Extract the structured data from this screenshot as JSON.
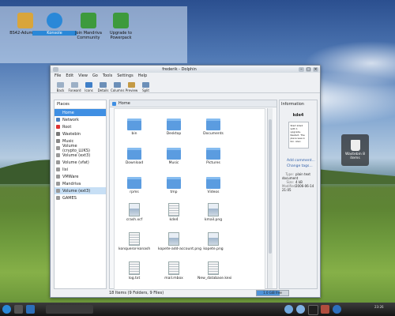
{
  "launcher": {
    "items": [
      {
        "label": "BS42-Adumicon",
        "color": "#d9a53b"
      },
      {
        "label": "Konsole",
        "color": "#2a88d8"
      },
      {
        "label": "Join Mandriva Community",
        "color": "#3d9a3d"
      },
      {
        "label": "Upgrade to Powerpack",
        "color": "#3d9a3d"
      }
    ]
  },
  "window": {
    "title": "frederik - Dolphin",
    "menu": [
      "File",
      "Edit",
      "View",
      "Go",
      "Tools",
      "Settings",
      "Help"
    ],
    "toolbar": [
      "Back",
      "Forward",
      "Icons",
      "Details",
      "Columns",
      "Preview",
      "Split"
    ]
  },
  "places": {
    "title": "Places",
    "items": [
      {
        "label": "Home",
        "icon": "home-icon",
        "color": "#3f8fe3",
        "state": "selected"
      },
      {
        "label": "Network",
        "icon": "network-icon",
        "color": "#4a7fc0"
      },
      {
        "label": "Root",
        "icon": "root-folder-icon",
        "color": "#d33"
      },
      {
        "label": "Wastebin",
        "icon": "trash-icon",
        "color": "#777"
      },
      {
        "label": "Music",
        "icon": "music-icon",
        "color": "#888"
      },
      {
        "label": "Volume (crypto_LUKS)",
        "icon": "drive-icon",
        "color": "#999"
      },
      {
        "label": "Volume (ext3)",
        "icon": "drive-icon",
        "color": "#999"
      },
      {
        "label": "Volume (vfat)",
        "icon": "drive-icon",
        "color": "#999"
      },
      {
        "label": "lixi",
        "icon": "drive-icon",
        "color": "#999"
      },
      {
        "label": "VMWare",
        "icon": "drive-icon",
        "color": "#999"
      },
      {
        "label": "Mandriva",
        "icon": "drive-icon",
        "color": "#999"
      },
      {
        "label": "Volume (ext3)",
        "icon": "drive-icon",
        "color": "#999",
        "state": "highlighted"
      },
      {
        "label": "GAMES",
        "icon": "drive-icon",
        "color": "#999"
      }
    ]
  },
  "content": {
    "breadcrumb": "Home",
    "files": [
      {
        "label": "bin",
        "type": "folder"
      },
      {
        "label": "Desktop",
        "type": "folder"
      },
      {
        "label": "Documents",
        "type": "folder"
      },
      {
        "label": "Download",
        "type": "folder"
      },
      {
        "label": "Music",
        "type": "folder"
      },
      {
        "label": "Pictures",
        "type": "folder"
      },
      {
        "label": "rpms",
        "type": "folder"
      },
      {
        "label": "tmp",
        "type": "folder"
      },
      {
        "label": "Videos",
        "type": "folder"
      },
      {
        "label": "crash.xcf",
        "type": "image"
      },
      {
        "label": "kde4",
        "type": "doc"
      },
      {
        "label": "kmail.png",
        "type": "image"
      },
      {
        "label": "konqueror-konash",
        "type": "doc"
      },
      {
        "label": "kopete-add-account.png",
        "type": "image"
      },
      {
        "label": "kopete.png",
        "type": "image"
      },
      {
        "label": "log.txt",
        "type": "doc"
      },
      {
        "label": "mail.mbox",
        "type": "doc"
      },
      {
        "label": "New_database.kexi",
        "type": "doc"
      }
    ]
  },
  "information": {
    "title": "Information",
    "filename": "kde4",
    "preview_text": "Start kde4 with 1 upgrade. Restart. The place was in bin. Also:",
    "links": [
      "Add comment...",
      "Change tags..."
    ],
    "meta": [
      {
        "key": "Type:",
        "value": "plain text document"
      },
      {
        "key": "Size:",
        "value": "4 kB"
      },
      {
        "key": "Modified:",
        "value": "2006-06-14 21:05"
      }
    ]
  },
  "status": {
    "text": "18 Items (9 Folders, 9 Files)",
    "free_space": "1.0 GiB free",
    "free_fraction": 0.72
  },
  "desktop": {
    "trash_label": "Wastebin 8 items"
  },
  "taskbar": {
    "clock": "23:26"
  }
}
